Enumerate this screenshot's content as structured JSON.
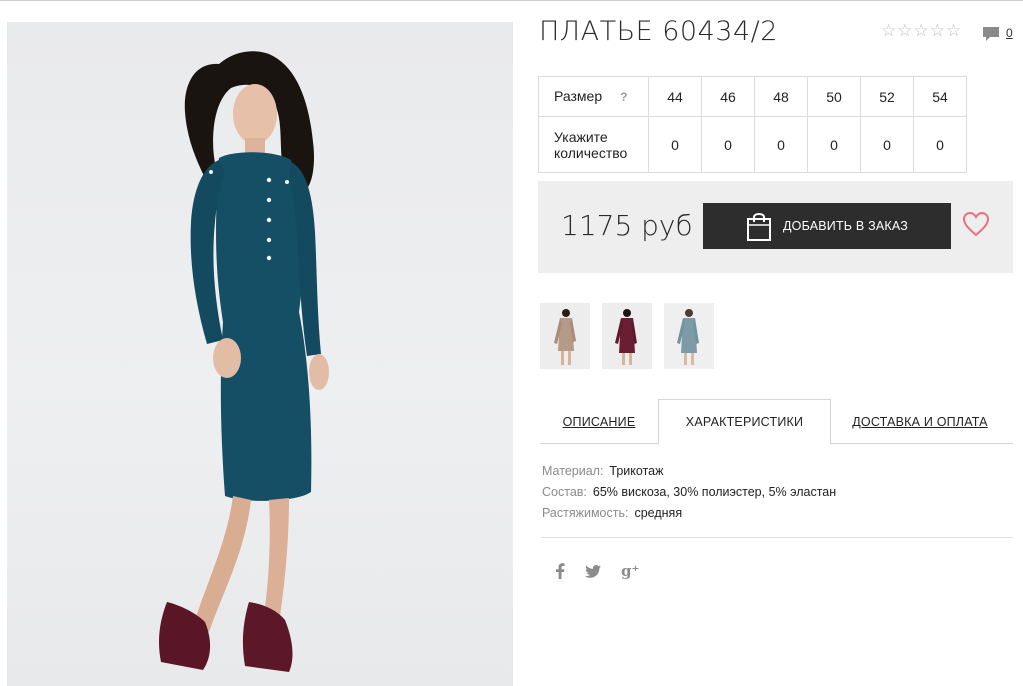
{
  "product": {
    "title": "ПЛАТЬЕ 60434/2",
    "rating_stars": [
      "☆",
      "☆",
      "☆",
      "☆",
      "☆"
    ],
    "comment_count": "0",
    "price": "1175 руб"
  },
  "sizes": {
    "size_label": "Размер",
    "help_mark": "?",
    "qty_label": "Укажите количество",
    "options": [
      "44",
      "46",
      "48",
      "50",
      "52",
      "54"
    ],
    "quantities": [
      "0",
      "0",
      "0",
      "0",
      "0",
      "0"
    ]
  },
  "actions": {
    "add_to_order": "ДОБАВИТЬ В ЗАКАЗ"
  },
  "tabs": [
    {
      "label": "ОПИСАНИЕ",
      "active": false
    },
    {
      "label": "ХАРАКТЕРИСТИКИ",
      "active": true
    },
    {
      "label": "ДОСТАВКА И ОПЛАТА",
      "active": false
    }
  ],
  "specs": [
    {
      "key": "Материал:",
      "value": "Трикотаж"
    },
    {
      "key": "Состав:",
      "value": "65% вискоза, 30% полиэстер, 5% эластан"
    },
    {
      "key": "Растяжимость:",
      "value": "средняя"
    }
  ],
  "social": {
    "google_plus_glyph": "g⁺"
  },
  "icons": [
    "star-icon",
    "comment-icon",
    "bag-icon",
    "heart-icon",
    "facebook-icon",
    "twitter-icon",
    "google-plus-icon"
  ],
  "colors": {
    "button_bg": "#2d2d2d",
    "price_box_bg": "#eeeeef",
    "heart": "#e8717f",
    "dress_main": "#154f66",
    "thumb_beige": "#b59a87",
    "thumb_burgundy": "#6b1e33",
    "thumb_blue_grey": "#7d9ba6"
  }
}
